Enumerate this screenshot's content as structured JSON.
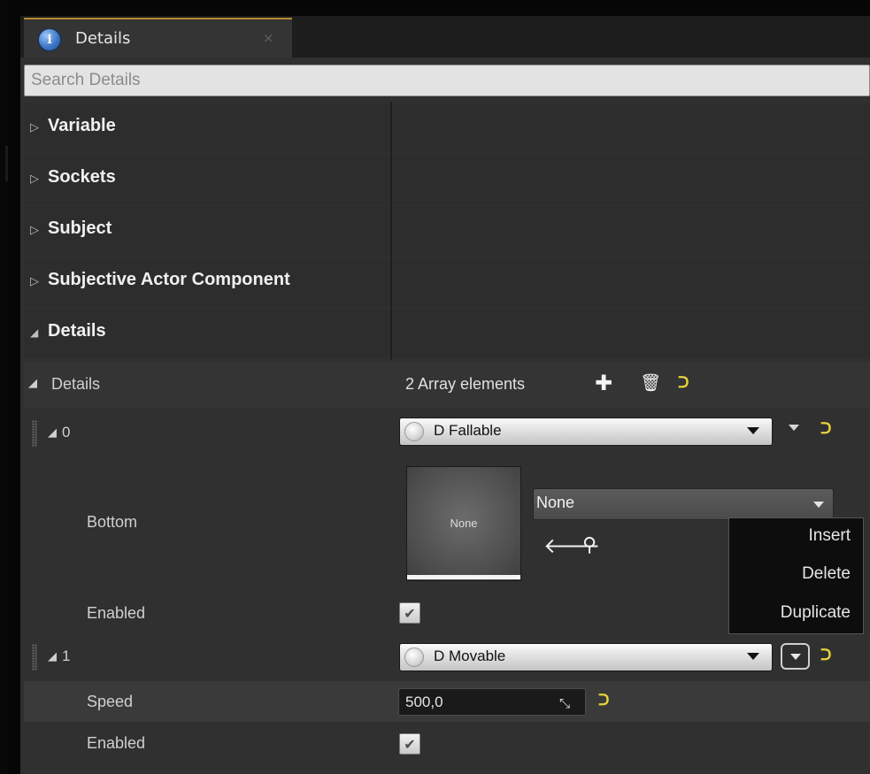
{
  "tab": {
    "label": "Details",
    "close": "×"
  },
  "search": {
    "placeholder": "Search Details"
  },
  "categories": [
    {
      "label": "Variable",
      "expanded": false
    },
    {
      "label": "Sockets",
      "expanded": false
    },
    {
      "label": "Subject",
      "expanded": false
    },
    {
      "label": "Subjective Actor Component",
      "expanded": false
    },
    {
      "label": "Details",
      "expanded": true
    }
  ],
  "icons": {
    "collapsed": "▷",
    "expanded": "◢",
    "add": "✚",
    "trash": "🗑",
    "reset": "ᑐ",
    "info": "i",
    "arrow_left": "🡐",
    "search": "⚲",
    "check": "✔",
    "drag": "⤡"
  },
  "details_array": {
    "label": "Details",
    "count_text": "2 Array elements",
    "elements": [
      {
        "index": "0",
        "class": "D Fallable",
        "properties": {
          "bottom_label": "Bottom",
          "bottom_value": "None",
          "bottom_thumb": "None",
          "enabled_label": "Enabled",
          "enabled": true
        }
      },
      {
        "index": "1",
        "class": "D Movable",
        "properties": {
          "speed_label": "Speed",
          "speed_value": "500,0",
          "enabled_label": "Enabled",
          "enabled": true
        }
      }
    ]
  },
  "context_menu": {
    "items": [
      "Insert",
      "Delete",
      "Duplicate"
    ]
  },
  "colors": {
    "panel_bg": "#303030",
    "tab_accent": "#b48a2c",
    "reset_arrow": "#e6d23a",
    "highlight_row": "#3a3a3a"
  }
}
